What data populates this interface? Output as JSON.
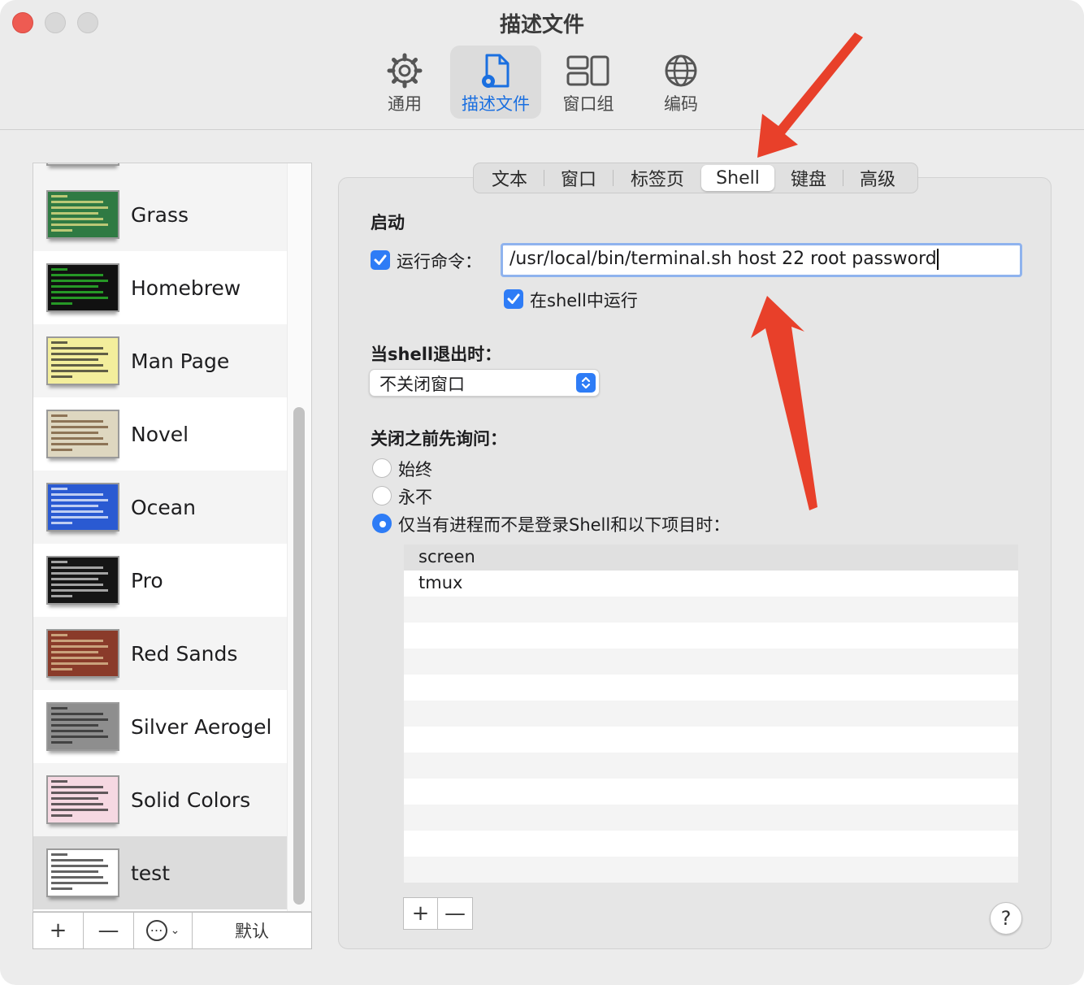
{
  "window": {
    "title": "描述文件"
  },
  "toolbar": {
    "items": [
      {
        "label": "通用",
        "icon": "gear-icon"
      },
      {
        "label": "描述文件",
        "icon": "profile-document-icon",
        "active": true
      },
      {
        "label": "窗口组",
        "icon": "window-group-icon"
      },
      {
        "label": "编码",
        "icon": "globe-icon"
      }
    ]
  },
  "sidebar": {
    "profiles": [
      {
        "name": "Grass",
        "bg": "#2f7a43",
        "fg": "#f6e98c"
      },
      {
        "name": "Homebrew",
        "bg": "#111111",
        "fg": "#2fd12f"
      },
      {
        "name": "Man Page",
        "bg": "#f3ee9c",
        "fg": "#222222"
      },
      {
        "name": "Novel",
        "bg": "#ded7c0",
        "fg": "#6b4a2a"
      },
      {
        "name": "Ocean",
        "bg": "#2a5ad2",
        "fg": "#ffffff"
      },
      {
        "name": "Pro",
        "bg": "#151515",
        "fg": "#e0e0e0"
      },
      {
        "name": "Red Sands",
        "bg": "#8a3b2a",
        "fg": "#e6cfa0"
      },
      {
        "name": "Silver Aerogel",
        "bg": "#8e8e8e",
        "fg": "#222222"
      },
      {
        "name": "Solid Colors",
        "bg": "#f6d8e2",
        "fg": "#222222"
      },
      {
        "name": "test",
        "bg": "#ffffff",
        "fg": "#222222",
        "selected": true
      }
    ],
    "buttons": {
      "add": "+",
      "remove": "—",
      "more": "⋯",
      "default": "默认"
    }
  },
  "tabs": [
    "文本",
    "窗口",
    "标签页",
    "Shell",
    "键盘",
    "高级"
  ],
  "active_tab": "Shell",
  "startup": {
    "heading": "启动",
    "run_command_label": "运行命令：",
    "run_command_checked": true,
    "command_value": "/usr/local/bin/terminal.sh host 22 root password",
    "run_in_shell_label": "在shell中运行",
    "run_in_shell_checked": true
  },
  "on_exit": {
    "heading": "当shell退出时：",
    "selected": "不关闭窗口"
  },
  "ask_before_close": {
    "heading": "关闭之前先询问：",
    "options": [
      {
        "label": "始终",
        "selected": false
      },
      {
        "label": "永不",
        "selected": false
      },
      {
        "label": "仅当有进程而不是登录Shell和以下项目时：",
        "selected": true
      }
    ],
    "processes": [
      "screen",
      "tmux"
    ]
  },
  "process_buttons": {
    "add": "+",
    "remove": "—"
  },
  "help": {
    "label": "?"
  },
  "annotation_color": "#e8402a"
}
